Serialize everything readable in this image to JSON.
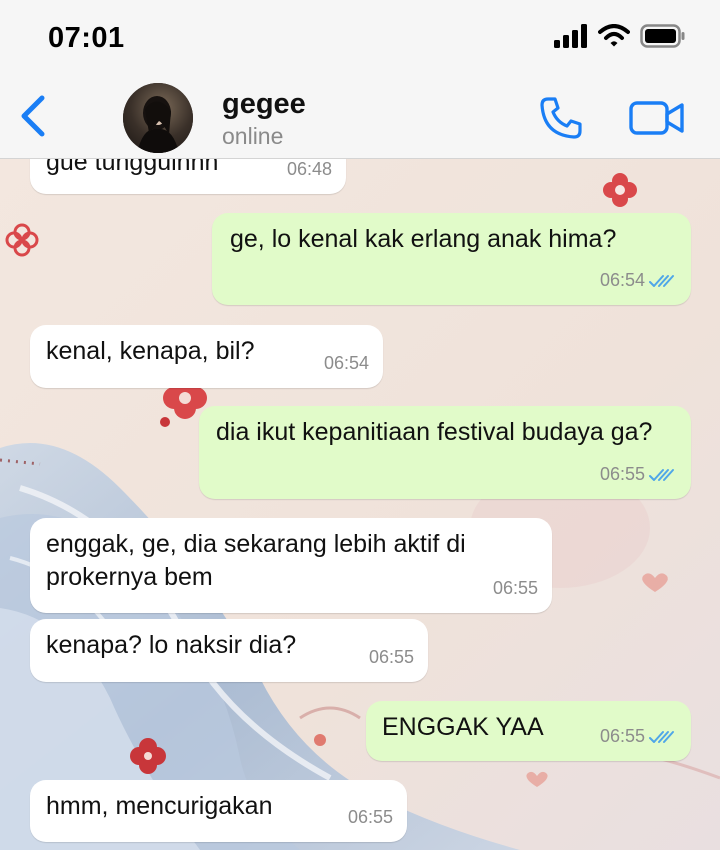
{
  "status_bar": {
    "time": "07:01"
  },
  "header": {
    "contact_name": "gegee",
    "contact_status": "online"
  },
  "messages": [
    {
      "direction": "in",
      "text": "gue tungguinnn",
      "time": "06:48"
    },
    {
      "direction": "out",
      "text": "ge, lo kenal kak erlang anak hima?",
      "time": "06:54",
      "read": true
    },
    {
      "direction": "in",
      "text": "kenal, kenapa, bil?",
      "time": "06:54"
    },
    {
      "direction": "out",
      "text": "dia ikut kepanitiaan festival budaya ga?",
      "time": "06:55",
      "read": true
    },
    {
      "direction": "in",
      "text": "enggak, ge, dia sekarang lebih aktif di prokernya bem",
      "time": "06:55"
    },
    {
      "direction": "in",
      "text": "kenapa? lo naksir dia?",
      "time": "06:55"
    },
    {
      "direction": "out",
      "text": "ENGGAK YAA",
      "time": "06:55",
      "read": true
    },
    {
      "direction": "in",
      "text": "hmm, mencurigakan",
      "time": "06:55"
    }
  ],
  "colors": {
    "accent": "#1a7ef5",
    "outgoing_bubble": "#e1fbc9",
    "incoming_bubble": "#ffffff",
    "read_ticks": "#4fa6e8"
  },
  "icons": {
    "back": "chevron-left-icon",
    "call": "phone-icon",
    "video": "video-camera-icon",
    "signal": "cellular-signal-icon",
    "wifi": "wifi-icon",
    "battery": "battery-icon",
    "read_receipt": "double-check-icon"
  }
}
